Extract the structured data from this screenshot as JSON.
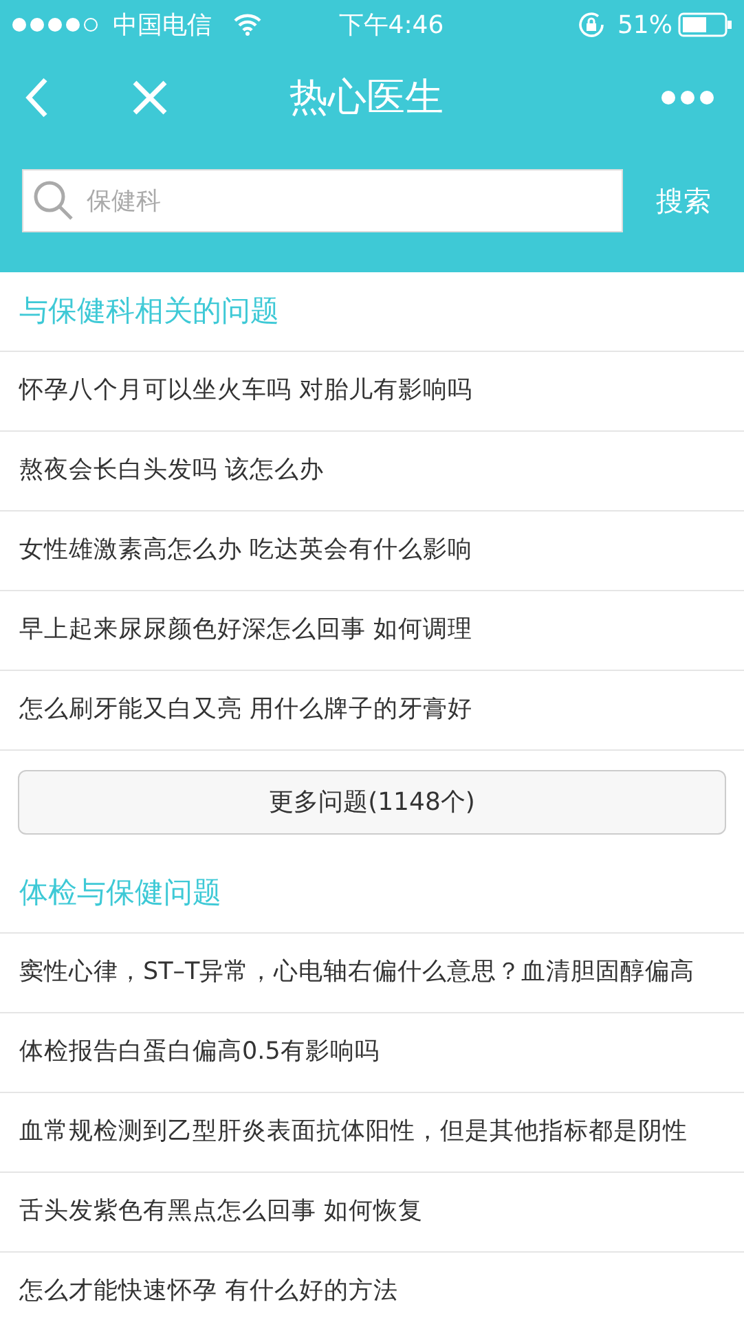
{
  "status_bar": {
    "carrier": "中国电信",
    "time": "下午4:46",
    "battery": "51%"
  },
  "nav": {
    "title": "热心医生"
  },
  "search": {
    "placeholder": "保健科",
    "button": "搜索"
  },
  "sections": [
    {
      "title": "与保健科相关的问题",
      "questions": [
        "怀孕八个月可以坐火车吗 对胎儿有影响吗",
        "熬夜会长白头发吗 该怎么办",
        "女性雄激素高怎么办 吃达英会有什么影响",
        "早上起来尿尿颜色好深怎么回事 如何调理",
        "怎么刷牙能又白又亮 用什么牌子的牙膏好"
      ],
      "more": "更多问题(1148个)"
    },
    {
      "title": "体检与保健问题",
      "questions": [
        "窦性心律，ST–T异常，心电轴右偏什么意思？血清胆固醇偏高",
        "体检报告白蛋白偏高0.5有影响吗",
        "血常规检测到乙型肝炎表面抗体阳性，但是其他指标都是阴性",
        "舌头发紫色有黑点怎么回事 如何恢复",
        "怎么才能快速怀孕 有什么好的方法"
      ]
    }
  ]
}
